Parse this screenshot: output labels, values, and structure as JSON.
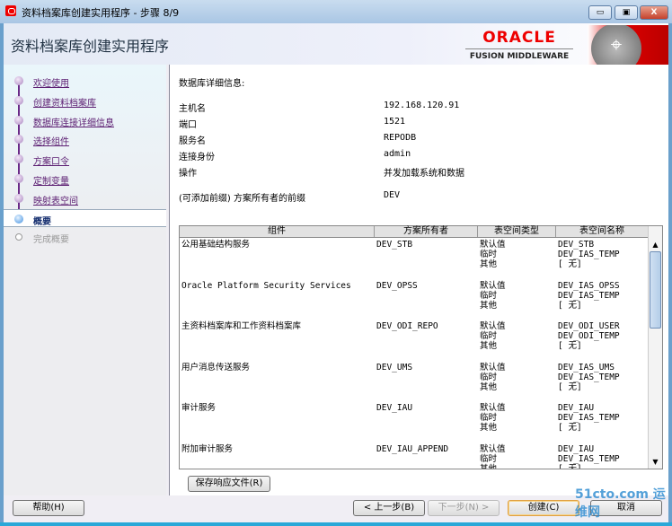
{
  "window": {
    "title": "资料档案库创建实用程序 - 步骤 8/9",
    "minimize": "▭",
    "maximize": "▣",
    "close": "X"
  },
  "header": {
    "app_title": "资料档案库创建实用程序",
    "logo_oracle": "ORACLE",
    "logo_sub": "FUSION MIDDLEWARE"
  },
  "steps": [
    {
      "label": "欢迎使用",
      "state": "done"
    },
    {
      "label": "创建资料档案库",
      "state": "done"
    },
    {
      "label": "数据库连接详细信息",
      "state": "done"
    },
    {
      "label": "选择组件",
      "state": "done"
    },
    {
      "label": "方案口令",
      "state": "done"
    },
    {
      "label": "定制变量",
      "state": "done"
    },
    {
      "label": "映射表空间",
      "state": "done"
    },
    {
      "label": "概要",
      "state": "current"
    },
    {
      "label": "完成概要",
      "state": "todo"
    }
  ],
  "details": {
    "heading": "数据库详细信息:",
    "rows": [
      {
        "label": "主机名",
        "value": "192.168.120.91"
      },
      {
        "label": "端口",
        "value": "1521"
      },
      {
        "label": "服务名",
        "value": "REPODB"
      },
      {
        "label": "连接身份",
        "value": "admin"
      },
      {
        "label": "操作",
        "value": "并发加载系统和数据"
      }
    ],
    "prefix_label": "(可添加前缀) 方案所有者的前缀",
    "prefix_value": "DEV"
  },
  "table": {
    "columns": [
      "组件",
      "方案所有者",
      "表空间类型",
      "表空间名称"
    ],
    "rows": [
      {
        "component": "公用基础结构服务",
        "owner": "DEV_STB",
        "types": "默认值\n临时\n其他",
        "names": "DEV_STB\nDEV_IAS_TEMP\n[ 无]"
      },
      {
        "component": "Oracle Platform Security Services",
        "owner": "DEV_OPSS",
        "types": "默认值\n临时\n其他",
        "names": "DEV_IAS_OPSS\nDEV_IAS_TEMP\n[ 无]"
      },
      {
        "component": "主资料档案库和工作资料档案库",
        "owner": "DEV_ODI_REPO",
        "types": "默认值\n临时\n其他",
        "names": "DEV_ODI_USER\nDEV_ODI_TEMP\n[ 无]"
      },
      {
        "component": "用户消息传送服务",
        "owner": "DEV_UMS",
        "types": "默认值\n临时\n其他",
        "names": "DEV_IAS_UMS\nDEV_IAS_TEMP\n[ 无]"
      },
      {
        "component": "审计服务",
        "owner": "DEV_IAU",
        "types": "默认值\n临时\n其他",
        "names": "DEV_IAU\nDEV_IAS_TEMP\n[ 无]"
      },
      {
        "component": "附加审计服务",
        "owner": "DEV_IAU_APPEND",
        "types": "默认值\n临时\n其他",
        "names": "DEV_IAU\nDEV_IAS_TEMP\n[ 无]"
      }
    ]
  },
  "buttons": {
    "save_response": "保存响应文件(R)",
    "help": "帮助(H)",
    "back": "< 上一步(B)",
    "next": "下一步(N) >",
    "create": "创建(C)",
    "cancel": "取消"
  },
  "watermark": "51cto.com 运维网"
}
